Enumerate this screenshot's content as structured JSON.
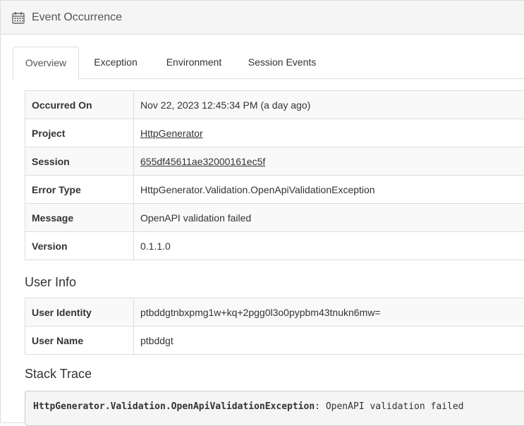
{
  "panel": {
    "title": "Event Occurrence",
    "icon": "calendar-icon"
  },
  "tabs": [
    {
      "label": "Overview",
      "active": true
    },
    {
      "label": "Exception",
      "active": false
    },
    {
      "label": "Environment",
      "active": false
    },
    {
      "label": "Session Events",
      "active": false
    }
  ],
  "overview": {
    "occurred_on": {
      "label": "Occurred On",
      "value": "Nov 22, 2023 12:45:34 PM (a day ago)"
    },
    "project": {
      "label": "Project",
      "value": "HttpGenerator"
    },
    "session": {
      "label": "Session",
      "value": "655df45611ae32000161ec5f"
    },
    "error_type": {
      "label": "Error Type",
      "value": "HttpGenerator.Validation.OpenApiValidationException"
    },
    "message": {
      "label": "Message",
      "value": "OpenAPI validation failed"
    },
    "version": {
      "label": "Version",
      "value": "0.1.1.0"
    }
  },
  "user_info": {
    "title": "User Info",
    "identity": {
      "label": "User Identity",
      "value": "ptbddgtnbxpmg1w+kq+2pgg0l3o0pypbm43tnukn6mw="
    },
    "name": {
      "label": "User Name",
      "value": "ptbddgt"
    }
  },
  "stack_trace": {
    "title": "Stack Trace",
    "exception_type": "HttpGenerator.Validation.OpenApiValidationException",
    "separator": ":",
    "message": " OpenAPI validation failed"
  }
}
